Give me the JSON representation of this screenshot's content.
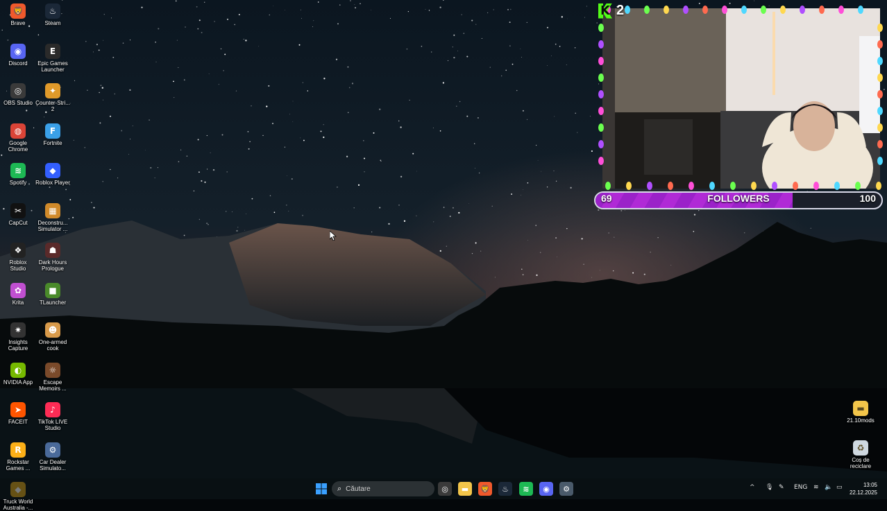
{
  "desktop_icons": [
    {
      "label": "Brave",
      "icon": "brave-icon",
      "color": "#f0592c",
      "glyph": "🦁"
    },
    {
      "label": "Steam",
      "icon": "steam-icon",
      "color": "#1b2838",
      "glyph": "♨"
    },
    {
      "label": "Discord",
      "icon": "discord-icon",
      "color": "#5865f2",
      "glyph": "◉"
    },
    {
      "label": "Epic Games\nLauncher",
      "icon": "epic-games-icon",
      "color": "#2a2a2a",
      "glyph": "E"
    },
    {
      "label": "OBS Studio",
      "icon": "obs-icon",
      "color": "#3a3a3a",
      "glyph": "◎"
    },
    {
      "label": "Counter-Stri...\n2",
      "icon": "counter-strike-icon",
      "color": "#e09a2a",
      "glyph": "✦"
    },
    {
      "label": "Google\nChrome",
      "icon": "chrome-icon",
      "color": "#db4437",
      "glyph": "◍"
    },
    {
      "label": "Fortnite",
      "icon": "fortnite-icon",
      "color": "#3aa0e8",
      "glyph": "F"
    },
    {
      "label": "Spotify",
      "icon": "spotify-icon",
      "color": "#1db954",
      "glyph": "≋"
    },
    {
      "label": "Roblox Player",
      "icon": "roblox-icon",
      "color": "#335fff",
      "glyph": "◆"
    },
    {
      "label": "CapCut",
      "icon": "capcut-icon",
      "color": "#111111",
      "glyph": "✂"
    },
    {
      "label": "Deconstru...\nSimulator ...",
      "icon": "deconstruction-sim-icon",
      "color": "#d08a2a",
      "glyph": "▦"
    },
    {
      "label": "Roblox\nStudio",
      "icon": "roblox-studio-icon",
      "color": "#222222",
      "glyph": "❖"
    },
    {
      "label": "Dark Hours\nPrologue",
      "icon": "dark-hours-icon",
      "color": "#5a2a2a",
      "glyph": "☗"
    },
    {
      "label": "Krita",
      "icon": "krita-icon",
      "color": "#c04fd0",
      "glyph": "✿"
    },
    {
      "label": "TLauncher",
      "icon": "tlauncher-icon",
      "color": "#4a8a2a",
      "glyph": "■"
    },
    {
      "label": "Insights\nCapture",
      "icon": "insights-capture-icon",
      "color": "#333333",
      "glyph": "✷"
    },
    {
      "label": "One-armed\ncook",
      "icon": "one-armed-cook-icon",
      "color": "#d89a4a",
      "glyph": "☻"
    },
    {
      "label": "NVIDIA App",
      "icon": "nvidia-icon",
      "color": "#76b900",
      "glyph": "◐"
    },
    {
      "label": "Escape\nMemoirs ...",
      "icon": "escape-memoirs-icon",
      "color": "#7a4a2a",
      "glyph": "☼"
    },
    {
      "label": "FACEIT",
      "icon": "faceit-icon",
      "color": "#ff5500",
      "glyph": "➤"
    },
    {
      "label": "TikTok LIVE\nStudio",
      "icon": "tiktok-live-icon",
      "color": "#fe2c55",
      "glyph": "♪"
    },
    {
      "label": "Rockstar\nGames ...",
      "icon": "rockstar-icon",
      "color": "#fcaf17",
      "glyph": "R"
    },
    {
      "label": "Car Dealer\nSimulato...",
      "icon": "car-dealer-icon",
      "color": "#4a6a9a",
      "glyph": "⚙"
    },
    {
      "label": "Truck World\nAustralia -...",
      "icon": "truck-world-icon",
      "color": "#d8a21a",
      "glyph": "◆"
    }
  ],
  "right_icons": [
    {
      "label": "21.10mods",
      "icon": "folder-icon",
      "color": "#f3c54a",
      "glyph": "▬"
    },
    {
      "label": "Coș de\nreciclare",
      "icon": "recycle-bin-icon",
      "color": "#cfd8e0",
      "glyph": "♻"
    }
  ],
  "overlay": {
    "viewer_count": "2",
    "followers_current": "69",
    "followers_label": "FOLLOWERS",
    "followers_goal": "100",
    "progress_fraction": 0.69
  },
  "taskbar": {
    "search_placeholder": "Căutare",
    "apps": [
      {
        "icon": "windows-start-icon",
        "color": "#3aa0ff",
        "glyph": "⊞"
      },
      {
        "icon": "obs-taskbar-icon",
        "color": "#3a3a3a",
        "glyph": "◎"
      },
      {
        "icon": "file-explorer-icon",
        "color": "#f3c54a",
        "glyph": "▬"
      },
      {
        "icon": "brave-taskbar-icon",
        "color": "#f0592c",
        "glyph": "🦁"
      },
      {
        "icon": "steam-taskbar-icon",
        "color": "#1b2838",
        "glyph": "♨"
      },
      {
        "icon": "spotify-taskbar-icon",
        "color": "#1db954",
        "glyph": "≋"
      },
      {
        "icon": "discord-taskbar-icon",
        "color": "#5865f2",
        "glyph": "◉"
      },
      {
        "icon": "settings-taskbar-icon",
        "color": "#4a5a6a",
        "glyph": "⚙"
      }
    ],
    "tray": {
      "chevron": "^",
      "language": "ENG",
      "time": "13:05",
      "date": "22.12.2025"
    }
  }
}
